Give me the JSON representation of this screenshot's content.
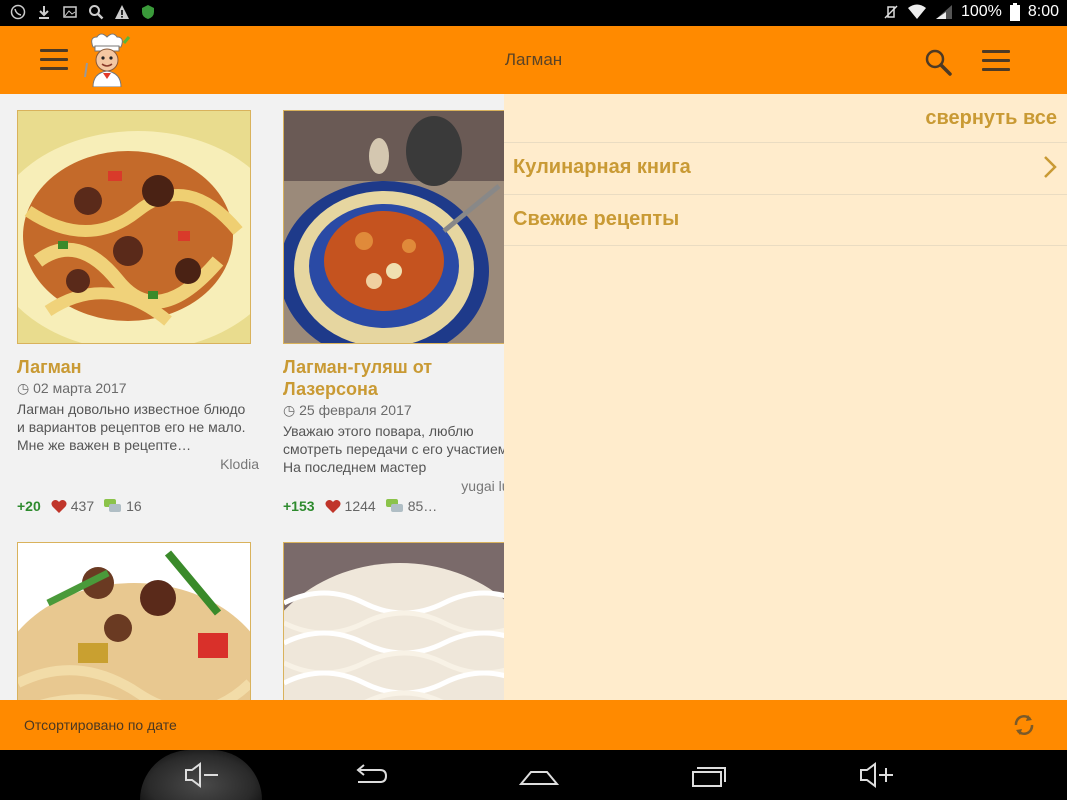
{
  "status_bar": {
    "battery": "100%",
    "time": "8:00"
  },
  "app_bar": {
    "title": "Лагман"
  },
  "recipes": [
    {
      "title": "Лагман",
      "date": "02 марта 2017",
      "description": "Лагман довольно известное блюдо и вариантов рецептов его не мало. Мне же важен в рецепте…",
      "author": "Klodia",
      "rating": "+20",
      "likes": "437",
      "comments": "16"
    },
    {
      "title": "Лагман-гуляш от Лазерсона",
      "date": "25 февраля 2017",
      "description": "Уважаю этого повара, люблю смотреть передачи с его участием. На последнем мастер",
      "author": "yugai ludmila",
      "rating": "+153",
      "likes": "1244",
      "comments": "85…"
    }
  ],
  "side_panel": {
    "collapse_all": "свернуть все",
    "items": [
      {
        "label": "Кулинарная книга"
      },
      {
        "label": "Свежие рецепты"
      }
    ]
  },
  "bottom_bar": {
    "sort_label": "Отсортировано по дате"
  },
  "colors": {
    "accent": "#ff8a00",
    "title_gold": "#c99a34",
    "panel_bg": "#ffeccc",
    "rating_green": "#2e8b2e"
  }
}
